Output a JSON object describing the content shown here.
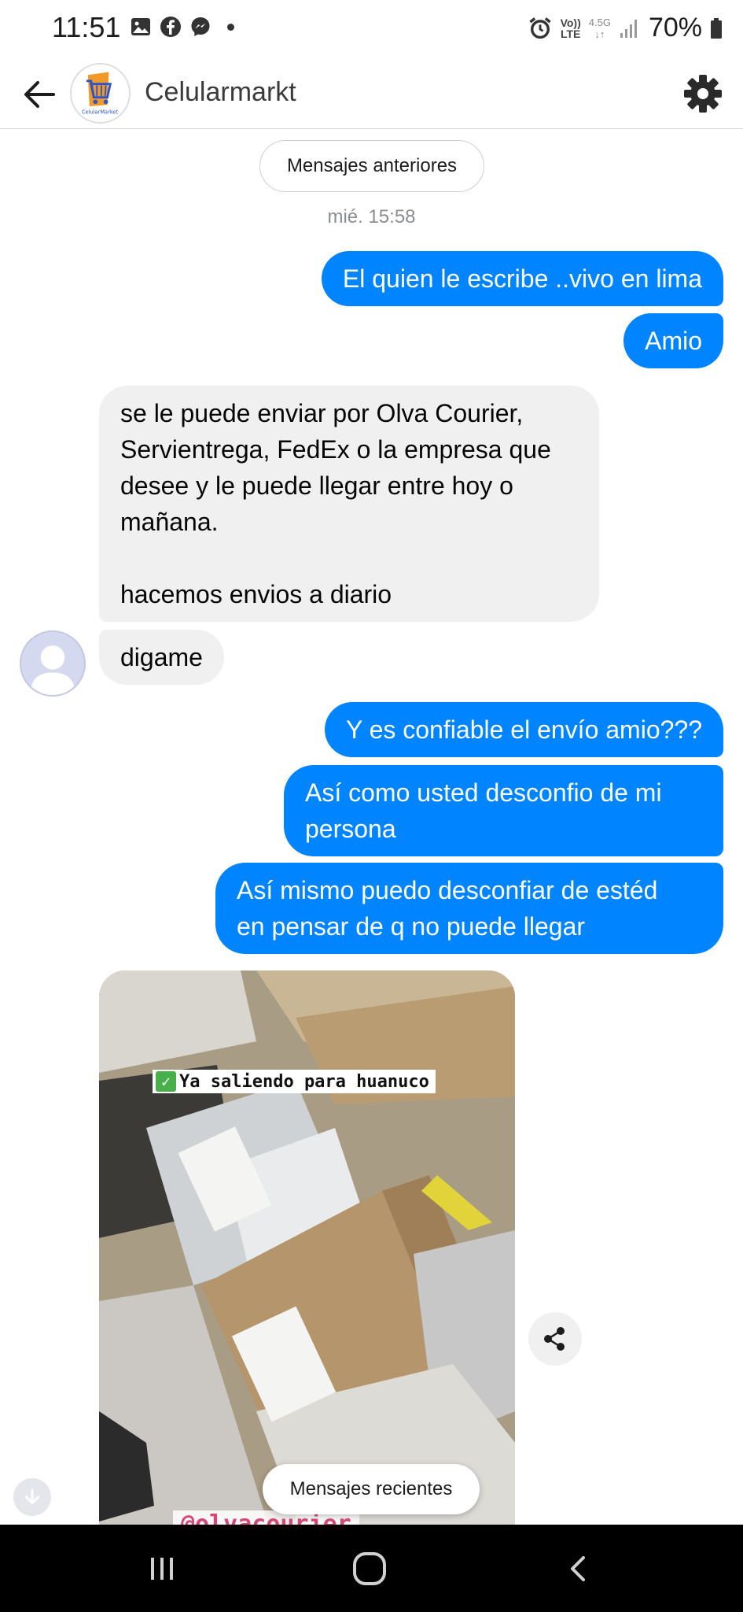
{
  "status_bar": {
    "time": "11:51",
    "left_icons": [
      "gallery-icon",
      "facebook-icon",
      "messenger-icon"
    ],
    "volte_top": "Vo))",
    "volte_bottom": "LTE",
    "network": "4.5G",
    "battery": "70%"
  },
  "header": {
    "title": "Celularmarkt",
    "logo_text": "CelularMarket"
  },
  "chat": {
    "older_messages_label": "Mensajes anteriores",
    "timestamp": "mié. 15:58",
    "messages": [
      {
        "from": "me",
        "text": "El quien le escribe ..vivo en lima"
      },
      {
        "from": "me",
        "text": "Amio"
      },
      {
        "from": "them",
        "text": "se le puede enviar por Olva Courier,\nServientrega, FedEx o la empresa que\ndesee y le puede llegar entre hoy o\nmañana.\n\nhacemos envios a diario"
      },
      {
        "from": "them",
        "text": "digame"
      },
      {
        "from": "me",
        "text": "Y es confiable el envío amio???"
      },
      {
        "from": "me",
        "text": "Así como usted desconfio de mi\npersona"
      },
      {
        "from": "me",
        "text": "Así mismo puedo desconfiar de estéd\nen pensar de q no puede llegar"
      }
    ],
    "media": {
      "caption": "Ya saliendo para huanuco",
      "watermark": "@olvacourier"
    },
    "recent_messages_label": "Mensajes recientes"
  },
  "colors": {
    "outgoing_bubble": "#0084ff",
    "incoming_bubble": "#f0f0f0",
    "nav_bar": "#000000"
  }
}
